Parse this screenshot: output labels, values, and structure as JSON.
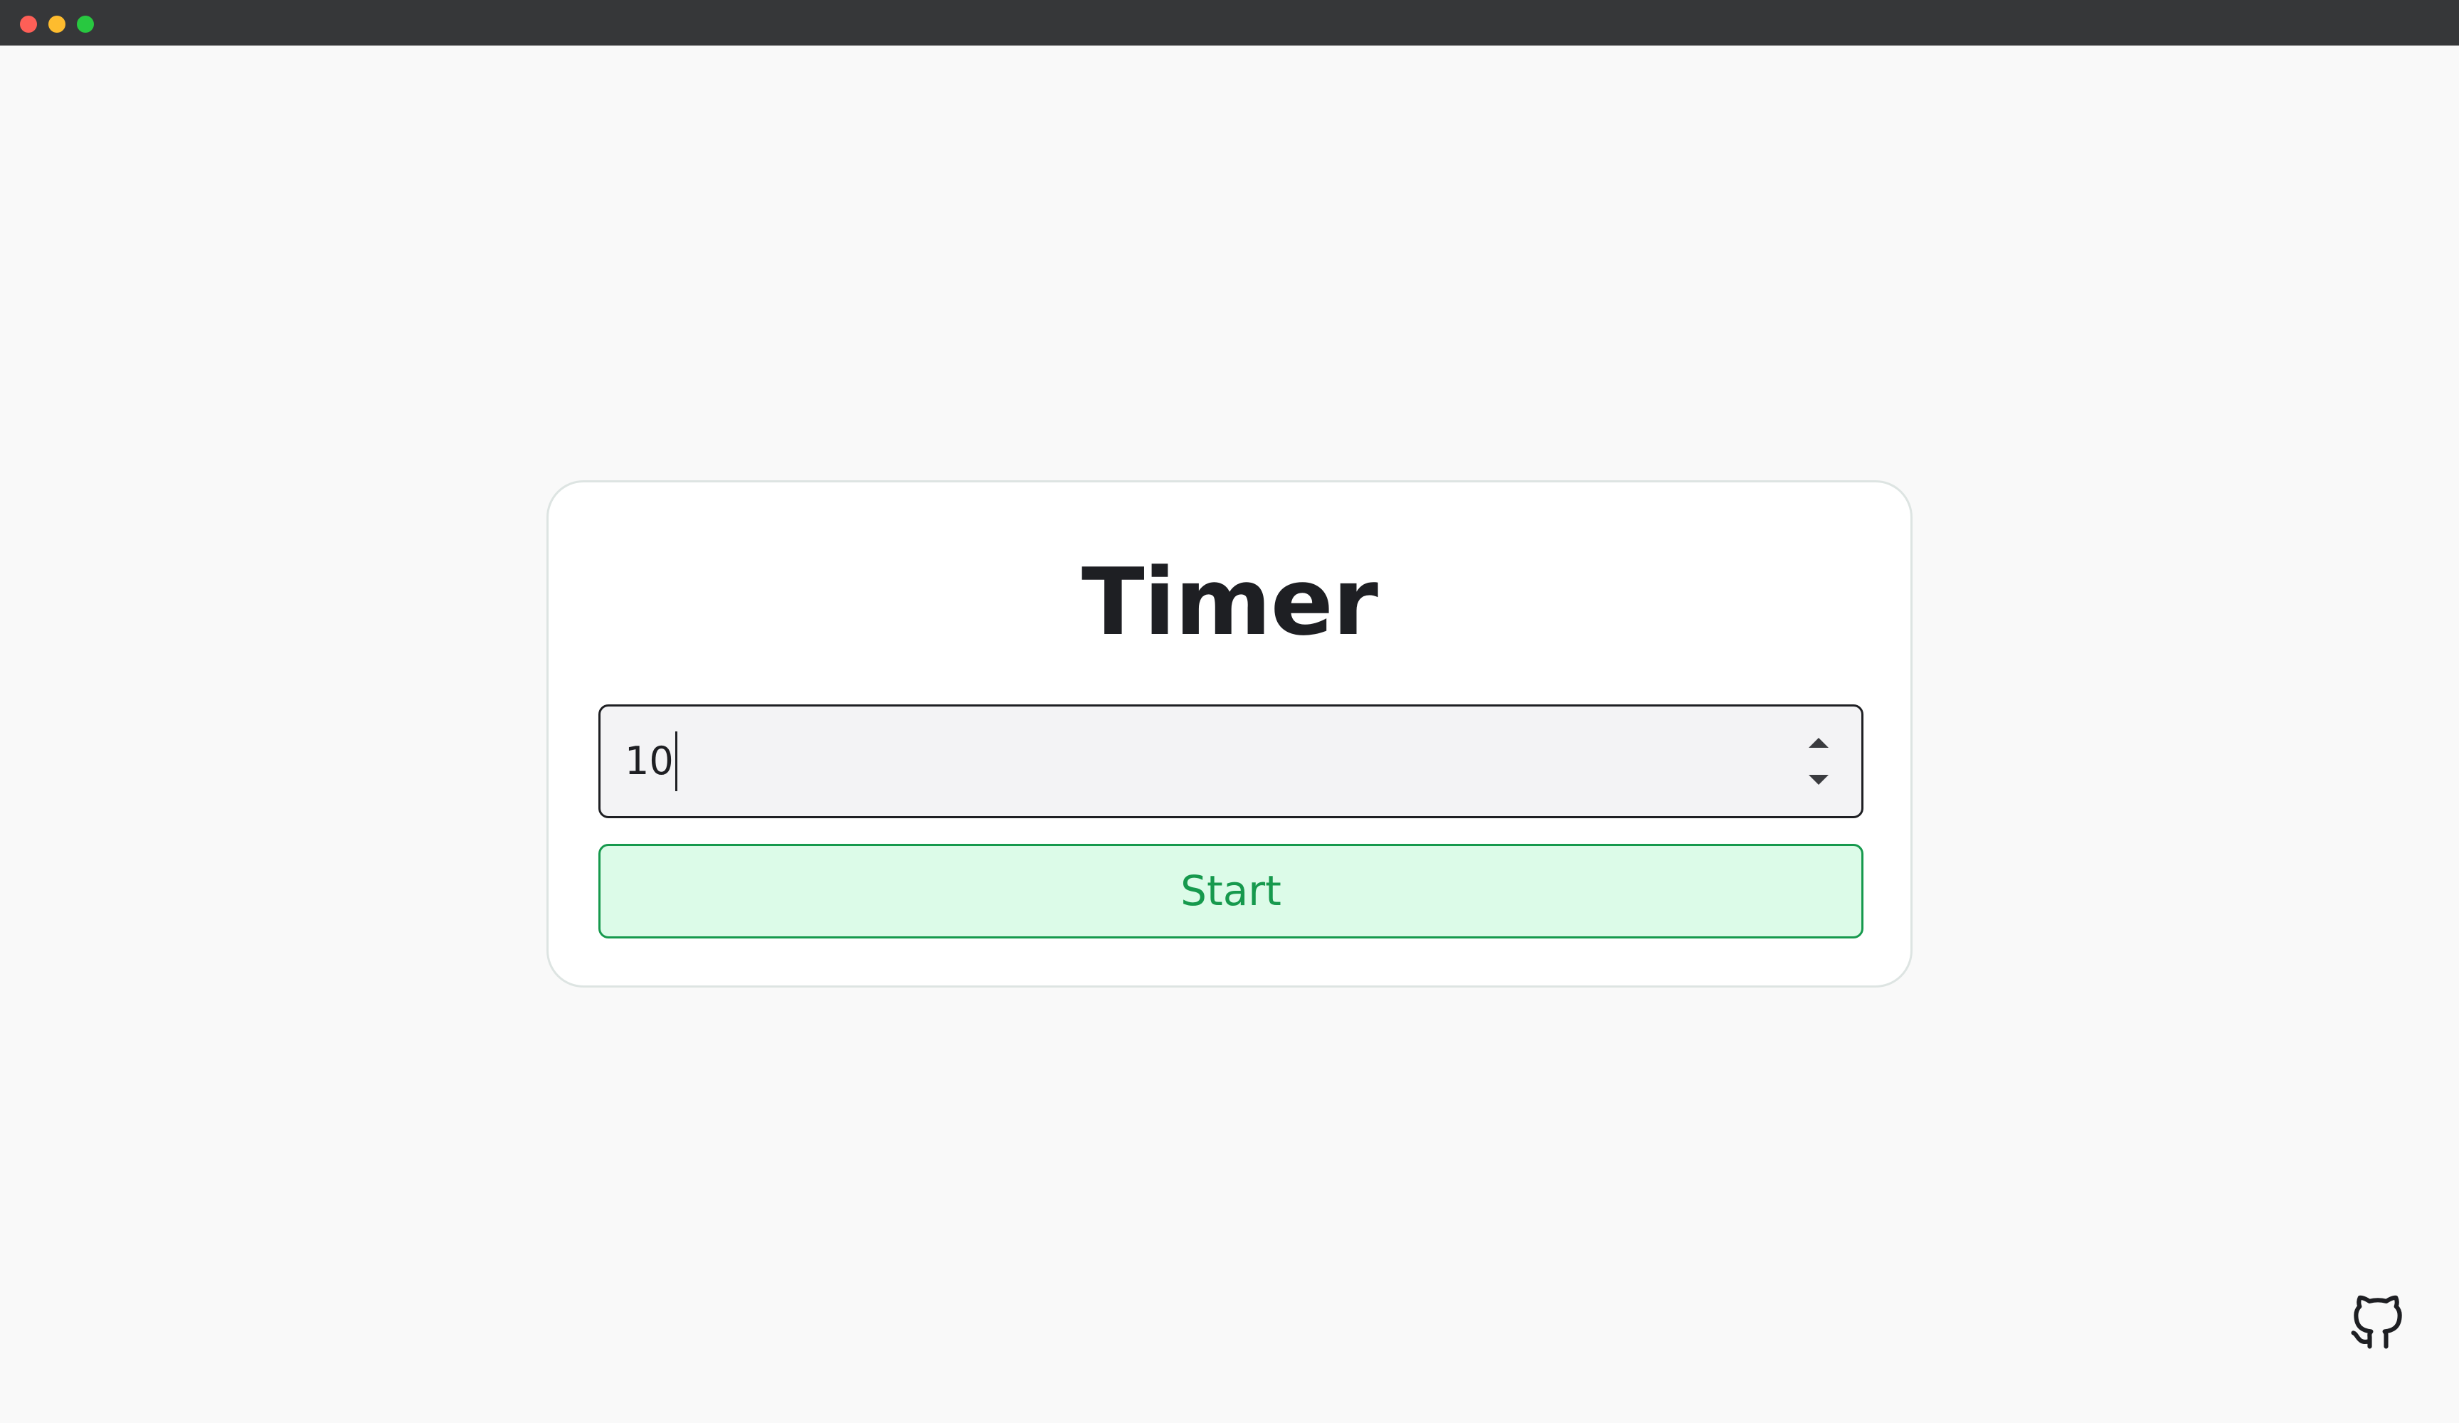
{
  "window": {
    "controls": [
      "close",
      "minimize",
      "maximize"
    ]
  },
  "timer_card": {
    "title": "Timer",
    "duration_input": {
      "value": "10",
      "type": "number"
    },
    "start_label": "Start"
  },
  "colors": {
    "background": "#f9f9f9",
    "titlebar": "#363739",
    "card": "#ffffff",
    "card_border": "#dde4e2",
    "input_bg": "#f3f3f5",
    "text": "#1e1f23",
    "start_bg": "#dcfbe8",
    "start_accent": "#16994d"
  },
  "footer": {
    "github_icon": "github-icon"
  }
}
